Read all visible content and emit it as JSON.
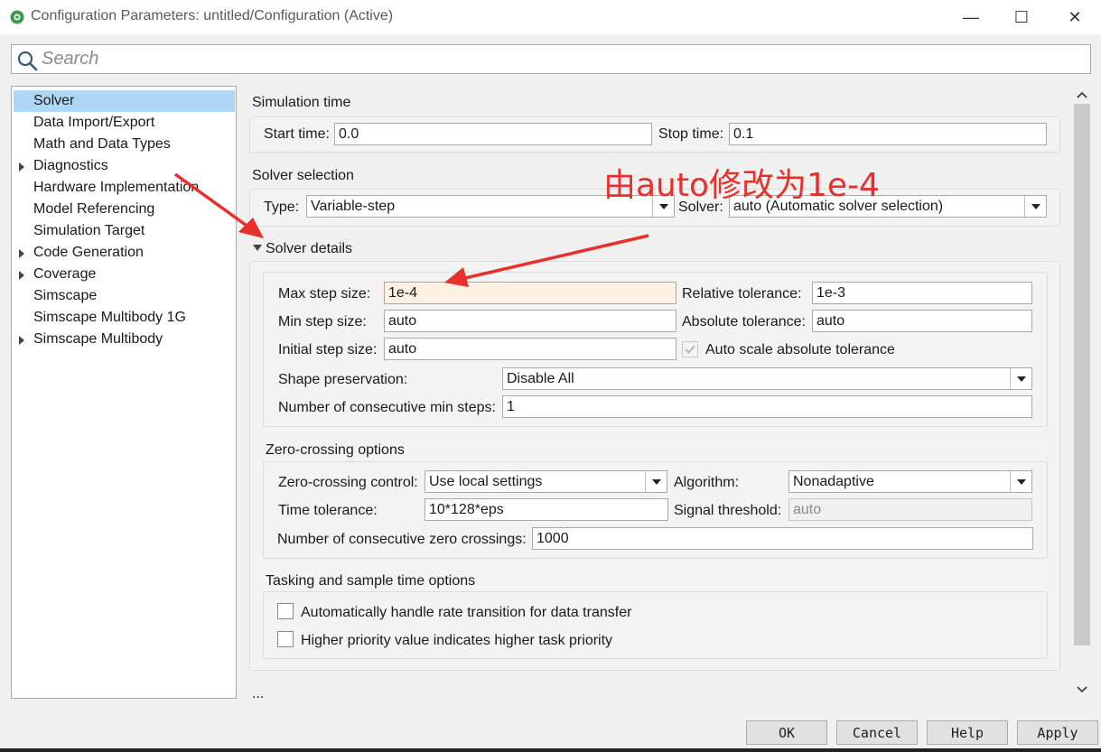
{
  "window": {
    "title": "Configuration Parameters: untitled/Configuration (Active)",
    "minimize": "—",
    "maximize": "☐",
    "close": "✕"
  },
  "search": {
    "placeholder": "Search"
  },
  "tree": {
    "items": [
      {
        "label": "Solver",
        "expandable": false,
        "selected": true
      },
      {
        "label": "Data Import/Export",
        "expandable": false
      },
      {
        "label": "Math and Data Types",
        "expandable": false
      },
      {
        "label": "Diagnostics",
        "expandable": true
      },
      {
        "label": "Hardware Implementation",
        "expandable": false
      },
      {
        "label": "Model Referencing",
        "expandable": false
      },
      {
        "label": "Simulation Target",
        "expandable": false
      },
      {
        "label": "Code Generation",
        "expandable": true
      },
      {
        "label": "Coverage",
        "expandable": true
      },
      {
        "label": "Simscape",
        "expandable": false
      },
      {
        "label": "Simscape Multibody 1G",
        "expandable": false
      },
      {
        "label": "Simscape Multibody",
        "expandable": true
      }
    ]
  },
  "simulation_time": {
    "title": "Simulation time",
    "start_label": "Start time:",
    "start_value": "0.0",
    "stop_label": "Stop time:",
    "stop_value": "0.1"
  },
  "solver_selection": {
    "title": "Solver selection",
    "type_label": "Type:",
    "type_value": "Variable-step",
    "solver_label": "Solver:",
    "solver_value": "auto (Automatic solver selection)"
  },
  "solver_details": {
    "title": "Solver details",
    "max_step_label": "Max step size:",
    "max_step_value": "1e-4",
    "min_step_label": "Min step size:",
    "min_step_value": "auto",
    "initial_step_label": "Initial step size:",
    "initial_step_value": "auto",
    "rel_tol_label": "Relative tolerance:",
    "rel_tol_value": "1e-3",
    "abs_tol_label": "Absolute tolerance:",
    "abs_tol_value": "auto",
    "auto_scale_label": "Auto scale absolute tolerance",
    "shape_label": "Shape preservation:",
    "shape_value": "Disable All",
    "consec_min_label": "Number of consecutive min steps:",
    "consec_min_value": "1"
  },
  "zero_crossing": {
    "title": "Zero-crossing options",
    "control_label": "Zero-crossing control:",
    "control_value": "Use local settings",
    "algorithm_label": "Algorithm:",
    "algorithm_value": "Nonadaptive",
    "time_tol_label": "Time tolerance:",
    "time_tol_value": "10*128*eps",
    "signal_label": "Signal threshold:",
    "signal_value": "auto",
    "consec_zero_label": "Number of consecutive zero crossings:",
    "consec_zero_value": "1000"
  },
  "tasking": {
    "title": "Tasking and sample time options",
    "rate_transition_label": "Automatically handle rate transition for data transfer",
    "priority_label": "Higher priority value indicates higher task priority"
  },
  "more": "...",
  "buttons": {
    "ok": "OK",
    "cancel": "Cancel",
    "help": "Help",
    "apply": "Apply"
  },
  "annotation": {
    "text": "由auto修改为1e-4",
    "color": "#e8302a"
  }
}
